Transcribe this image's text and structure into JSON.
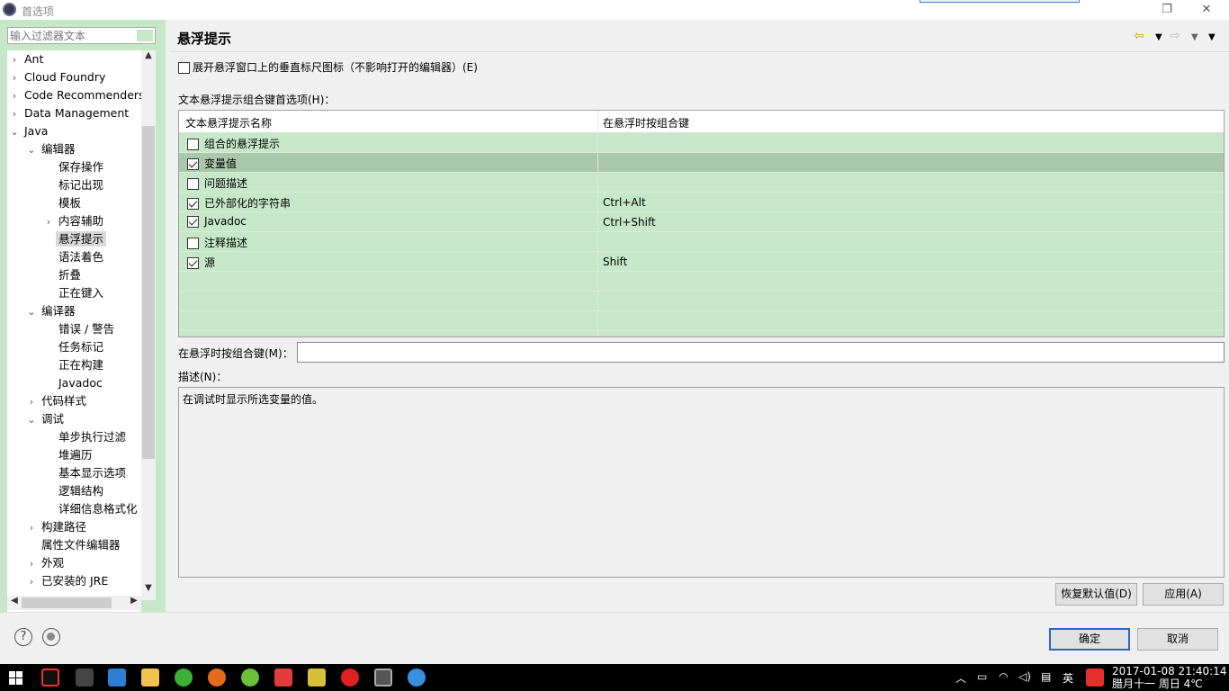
{
  "window": {
    "title": "首选项",
    "restore": "❐",
    "close": "✕"
  },
  "sidebar": {
    "filter_placeholder": "输入过滤器文本",
    "items": [
      {
        "label": "Ant",
        "indent": 0,
        "arrow": "›"
      },
      {
        "label": "Cloud Foundry",
        "indent": 0,
        "arrow": "›"
      },
      {
        "label": "Code Recommenders",
        "indent": 0,
        "arrow": "›"
      },
      {
        "label": "Data Management",
        "indent": 0,
        "arrow": "›"
      },
      {
        "label": "Java",
        "indent": 0,
        "arrow": "⌄"
      },
      {
        "label": "编辑器",
        "indent": 1,
        "arrow": "⌄"
      },
      {
        "label": "保存操作",
        "indent": 2,
        "arrow": ""
      },
      {
        "label": "标记出现",
        "indent": 2,
        "arrow": ""
      },
      {
        "label": "模板",
        "indent": 2,
        "arrow": ""
      },
      {
        "label": "内容辅助",
        "indent": 2,
        "arrow": "›"
      },
      {
        "label": "悬浮提示",
        "indent": 2,
        "arrow": "",
        "selected": true
      },
      {
        "label": "语法着色",
        "indent": 2,
        "arrow": ""
      },
      {
        "label": "折叠",
        "indent": 2,
        "arrow": ""
      },
      {
        "label": "正在键入",
        "indent": 2,
        "arrow": ""
      },
      {
        "label": "编译器",
        "indent": 1,
        "arrow": "⌄"
      },
      {
        "label": "错误 / 警告",
        "indent": 2,
        "arrow": ""
      },
      {
        "label": "任务标记",
        "indent": 2,
        "arrow": ""
      },
      {
        "label": "正在构建",
        "indent": 2,
        "arrow": ""
      },
      {
        "label": "Javadoc",
        "indent": 2,
        "arrow": ""
      },
      {
        "label": "代码样式",
        "indent": 1,
        "arrow": "›"
      },
      {
        "label": "调试",
        "indent": 1,
        "arrow": "⌄"
      },
      {
        "label": "单步执行过滤",
        "indent": 2,
        "arrow": ""
      },
      {
        "label": "堆遍历",
        "indent": 2,
        "arrow": ""
      },
      {
        "label": "基本显示选项",
        "indent": 2,
        "arrow": ""
      },
      {
        "label": "逻辑结构",
        "indent": 2,
        "arrow": ""
      },
      {
        "label": "详细信息格式化",
        "indent": 2,
        "arrow": ""
      },
      {
        "label": "构建路径",
        "indent": 1,
        "arrow": "›"
      },
      {
        "label": "属性文件编辑器",
        "indent": 1,
        "arrow": ""
      },
      {
        "label": "外观",
        "indent": 1,
        "arrow": "›"
      },
      {
        "label": "已安装的 JRE",
        "indent": 1,
        "arrow": "›"
      }
    ]
  },
  "main": {
    "title": "悬浮提示",
    "vertical_ruler_option": "展开悬浮窗口上的垂直标尺图标（不影响打开的编辑器）(E)",
    "combo_section_label": "文本悬浮提示组合键首选项(H)：",
    "table": {
      "col1": "文本悬浮提示名称",
      "col2": "在悬浮时按组合键",
      "rows": [
        {
          "name": "组合的悬浮提示",
          "key": "",
          "checked": false,
          "selected": false
        },
        {
          "name": "变量值",
          "key": "",
          "checked": true,
          "selected": true
        },
        {
          "name": "问题描述",
          "key": "",
          "checked": false,
          "selected": false
        },
        {
          "name": "已外部化的字符串",
          "key": "Ctrl+Alt",
          "checked": true,
          "selected": false
        },
        {
          "name": "Javadoc",
          "key": "Ctrl+Shift",
          "checked": true,
          "selected": false
        },
        {
          "name": "注释描述",
          "key": "",
          "checked": false,
          "selected": false
        },
        {
          "name": "源",
          "key": "Shift",
          "checked": true,
          "selected": false
        }
      ]
    },
    "modifier_label": "在悬浮时按组合键(M)：",
    "modifier_value": "",
    "desc_label": "描述(N)：",
    "desc_text": "在调试时显示所选变量的值。",
    "restore_defaults": "恢复默认值(D)",
    "apply": "应用(A)"
  },
  "footer": {
    "ok": "确定",
    "cancel": "取消",
    "help": "?"
  },
  "taskbar": {
    "tray_lang": "英",
    "time": "2017-01-08  21:40:14",
    "date_line": "腊月十一 周日 4℃"
  },
  "colors": {
    "sidebar_bg": "#c6e8c8",
    "selected_row": "#a9c7aa",
    "primary_border": "#2a66c7"
  }
}
